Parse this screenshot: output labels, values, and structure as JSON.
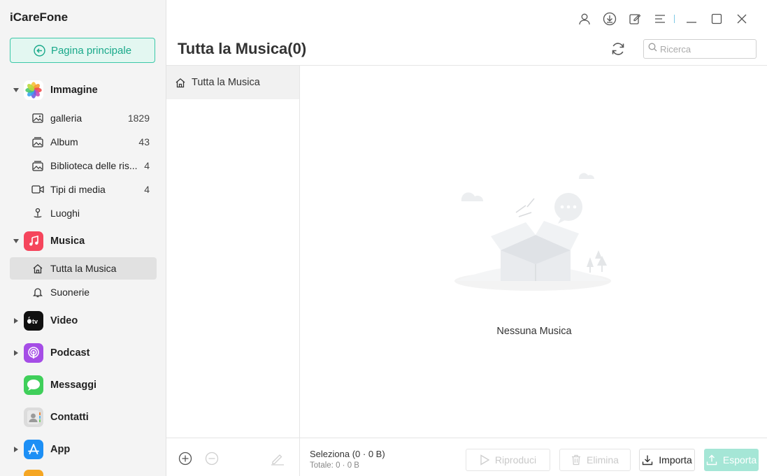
{
  "app": {
    "title": "iCareFone"
  },
  "home_button": {
    "label": "Pagina principale"
  },
  "sidebar": {
    "categories": {
      "immagine": {
        "label": "Immagine",
        "icon": "photos-icon"
      },
      "musica": {
        "label": "Musica",
        "icon": "music-icon"
      },
      "video": {
        "label": "Video",
        "icon": "tv-icon"
      },
      "podcast": {
        "label": "Podcast",
        "icon": "podcast-icon"
      },
      "messaggi": {
        "label": "Messaggi",
        "icon": "messages-icon"
      },
      "contatti": {
        "label": "Contatti",
        "icon": "contacts-icon"
      },
      "app": {
        "label": "App",
        "icon": "appstore-icon"
      }
    },
    "immagine_items": [
      {
        "label": "galleria",
        "count": "1829",
        "icon": "image-icon"
      },
      {
        "label": "Album",
        "count": "43",
        "icon": "album-icon"
      },
      {
        "label": "Biblioteca delle ris...",
        "count": "4",
        "icon": "library-icon"
      },
      {
        "label": "Tipi di media",
        "count": "4",
        "icon": "video-camera-icon"
      },
      {
        "label": "Luoghi",
        "count": "",
        "icon": "location-pin-icon"
      }
    ],
    "musica_items": [
      {
        "label": "Tutta la Musica",
        "icon": "home-icon",
        "active": true
      },
      {
        "label": "Suonerie",
        "icon": "bell-icon"
      }
    ]
  },
  "header": {
    "page_title": "Tutta la Musica(0)",
    "search_placeholder": "Ricerca"
  },
  "middle_panel": {
    "item_label": "Tutta la Musica"
  },
  "main": {
    "empty_text": "Nessuna Musica"
  },
  "footer": {
    "selection": "Seleziona (0 · 0 B)",
    "total": "Totale: 0 · 0 B",
    "buttons": {
      "play": "Riproduci",
      "delete": "Elimina",
      "import": "Importa",
      "export": "Esporta"
    }
  },
  "colors": {
    "accent": "#19a98a",
    "accent_light": "#e3f7f1",
    "music_red": "#f5455c",
    "podcast_purple": "#a54de6",
    "messages_green": "#3fcf5a",
    "appstore_blue": "#1d8ff5"
  }
}
